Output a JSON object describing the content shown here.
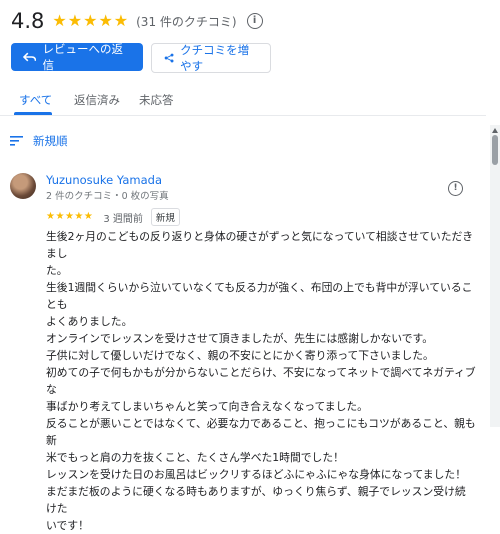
{
  "rating": {
    "value": "4.8",
    "star_count": 5,
    "count_text": "(31 件のクチコミ)"
  },
  "actions": {
    "reply_label": "レビューへの返信",
    "get_more_label": "クチコミを増やす"
  },
  "tabs": [
    {
      "label": "すべて",
      "active": true
    },
    {
      "label": "返信済み",
      "active": false
    },
    {
      "label": "未応答",
      "active": false
    }
  ],
  "sort": {
    "label": "新規順"
  },
  "review": {
    "author": "Yuzunosuke Yamada",
    "meta": "2 件のクチコミ・0 枚の写真",
    "stars": 5,
    "time": "3 週間前",
    "badge": "新規",
    "lines": [
      "生後2ヶ月のこどもの反り返りと身体の硬さがずっと気になっていて相談させていただきまし",
      "た。",
      "生後1週間くらいから泣いていなくても反る力が強く、布団の上でも背中が浮いていることも",
      "よくありました。",
      "オンラインでレッスンを受けさせて頂きましたが、先生には感謝しかないです。",
      "子供に対して優しいだけでなく、親の不安にとにかく寄り添って下さいました。",
      "初めての子で何もかもが分からないことだらけ、不安になってネットで調べてネガティブな",
      "事ばかり考えてしまいちゃんと笑って向き合えなくなってました。",
      "反ることが悪いことではなくて、必要な力であること、抱っこにもコツがあること、親も新",
      "米でもっと肩の力を抜くこと、たくさん学べた1時間でした！",
      "レッスンを受けた日のお風呂はビックリするほどふにゃふにゃな身体になってました！",
      "まだまだ板のように硬くなる時もありますが、ゆっくり焦らず、親子でレッスン受け続けた",
      "いです！"
    ]
  },
  "colors": {
    "accent": "#1a73e8",
    "star": "#fbbc04",
    "secondary_text": "#5f6368"
  }
}
